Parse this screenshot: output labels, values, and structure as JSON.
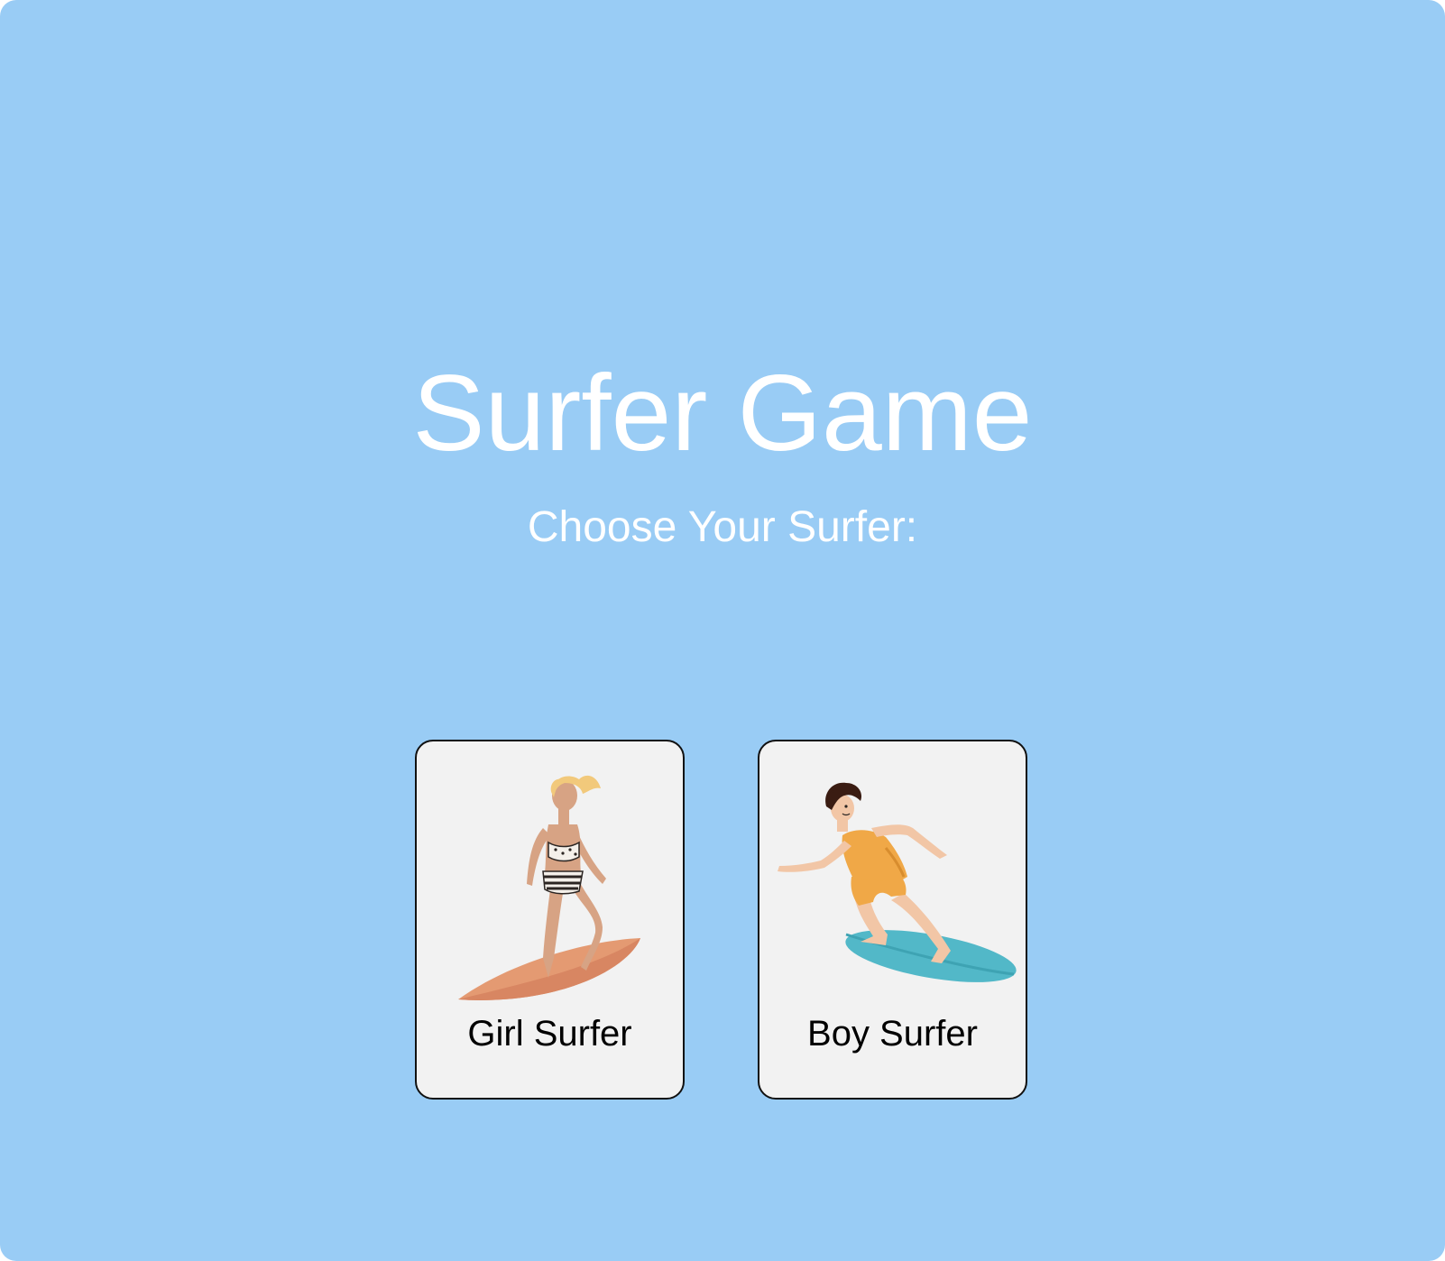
{
  "game": {
    "title": "Surfer Game",
    "prompt": "Choose Your Surfer:"
  },
  "characters": [
    {
      "id": "girl",
      "label": "Girl Surfer",
      "icon": "girl-surfer-illustration",
      "board_color": "#e49a72"
    },
    {
      "id": "boy",
      "label": "Boy Surfer",
      "icon": "boy-surfer-illustration",
      "board_color": "#52b8c8"
    }
  ],
  "colors": {
    "background": "#99ccf5",
    "card": "#f2f2f2",
    "title_text": "#ffffff"
  }
}
